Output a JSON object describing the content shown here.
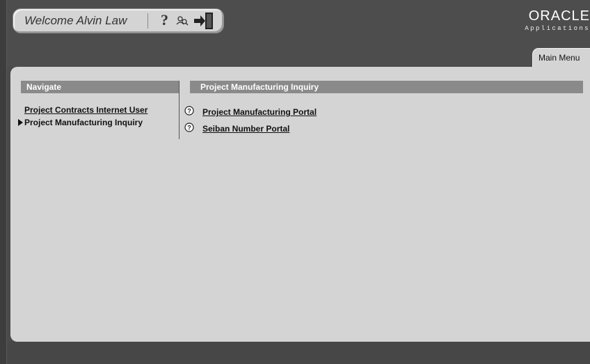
{
  "header": {
    "welcome_text": "Welcome Alvin Law",
    "icons": {
      "help": "help-icon",
      "people_search": "people-search-icon",
      "logout": "logout-icon"
    },
    "help_glyph": "?"
  },
  "branding": {
    "logo_word": "ORACLE",
    "logo_sub": "Applications"
  },
  "tabs": [
    {
      "label": "Main Menu",
      "selected": true
    }
  ],
  "navigate": {
    "header": "Navigate",
    "items": [
      {
        "label": "Project Contracts Internet User",
        "selected": false
      },
      {
        "label": "Project Manufacturing Inquiry",
        "selected": true
      }
    ]
  },
  "content": {
    "header": "Project Manufacturing Inquiry",
    "links": [
      {
        "label": "Project Manufacturing Portal",
        "icon": "portal-help-icon"
      },
      {
        "label": "Seiban Number Portal",
        "icon": "portal-help-icon"
      }
    ]
  },
  "colors": {
    "chrome": "#4d4d4d",
    "panel": "#d4d4d4",
    "section_header": "#8a8a8a"
  }
}
